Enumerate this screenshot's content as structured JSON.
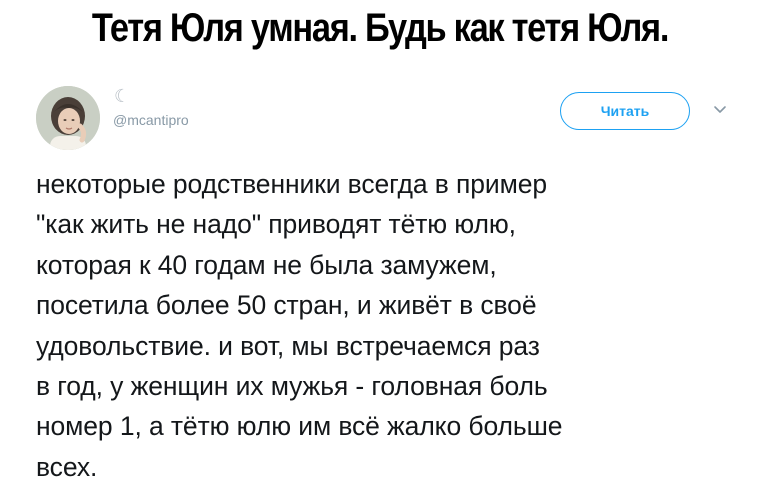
{
  "headline": "Тетя Юля умная. Будь как тетя Юля.",
  "author": {
    "handle": "@mcantipro",
    "badge_glyph": "☾"
  },
  "follow_button": {
    "label": "Читать"
  },
  "tweet": {
    "lines": [
      "некоторые родственники всегда в пример",
      "\"как жить не надо\" приводят тётю юлю,",
      "которая к 40 годам не была замужем,",
      "посетила более 50 стран, и живёт в своё",
      "удовольствие. и вот, мы встречаемся раз",
      "в год, у женщин их мужья - головная боль",
      "номер 1, а тётю юлю им всё жалко больше",
      "всех."
    ]
  },
  "colors": {
    "accent": "#1da1f2",
    "text": "#14171a",
    "muted": "#8899a6"
  }
}
